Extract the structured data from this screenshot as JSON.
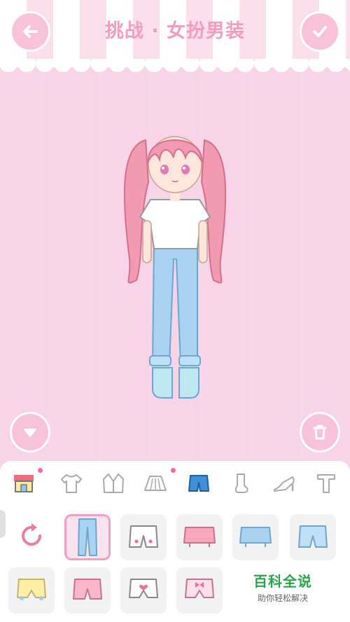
{
  "header": {
    "title": "挑战 · 女扮男装"
  },
  "colors": {
    "accent": "#f49cc0",
    "background": "#f7d4e7",
    "selected_border": "#f39ec3",
    "badge": "#f36a9e"
  },
  "categories": [
    {
      "name": "store",
      "icon": "shop-icon",
      "badge": true
    },
    {
      "name": "top",
      "icon": "tshirt-icon",
      "badge": false
    },
    {
      "name": "jacket",
      "icon": "jacket-icon",
      "badge": false
    },
    {
      "name": "skirt",
      "icon": "skirt-icon",
      "badge": true
    },
    {
      "name": "shorts",
      "icon": "shorts-icon",
      "badge": false,
      "active": true
    },
    {
      "name": "socks",
      "icon": "sock-icon",
      "badge": false
    },
    {
      "name": "shoes",
      "icon": "heel-icon",
      "badge": false
    },
    {
      "name": "pants",
      "icon": "pants-icon",
      "badge": false
    }
  ],
  "items": [
    {
      "icon": "jeans-icon",
      "selected": true
    },
    {
      "icon": "white-shorts-icon",
      "selected": false
    },
    {
      "icon": "pink-skirt-shorts-icon",
      "selected": false
    },
    {
      "icon": "blue-skirt-shorts-icon",
      "selected": false
    },
    {
      "icon": "blue-denim-shorts-icon",
      "selected": false
    },
    {
      "icon": "yellow-bloomers-icon",
      "selected": false
    },
    {
      "icon": "pink-shorts-icon",
      "selected": false
    },
    {
      "icon": "heart-bloomers-icon",
      "selected": false
    },
    {
      "icon": "bow-bloomers-icon",
      "selected": false
    }
  ],
  "watermark": {
    "main": "百科全说",
    "sub": "助你轻松解决"
  }
}
